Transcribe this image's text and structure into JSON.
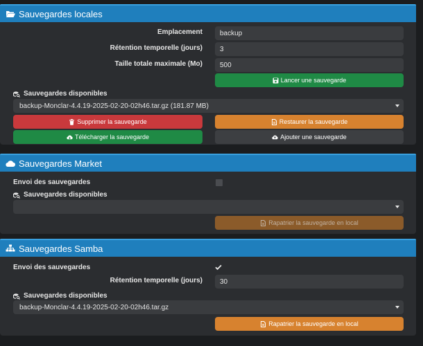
{
  "local": {
    "title": "Sauvegardes locales",
    "labels": {
      "location": "Emplacement",
      "retention": "Rétention temporelle (jours)",
      "max_size": "Taille totale maximale (Mo)",
      "available": "Sauvegardes disponibles"
    },
    "values": {
      "location": "backup",
      "retention": "3",
      "max_size": "500"
    },
    "buttons": {
      "launch": "Lancer une sauvegarde",
      "delete": "Supprimer la sauvegarde",
      "restore": "Restaurer la sauvegarde",
      "download": "Télécharger la sauvegarde",
      "add": "Ajouter une sauvegarde"
    },
    "selected_backup": "backup-Monclar-4.4.19-2025-02-20-02h46.tar.gz (181.87 MB)"
  },
  "market": {
    "title": "Sauvegardes Market",
    "labels": {
      "send": "Envoi des sauvegardes",
      "available": "Sauvegardes disponibles"
    },
    "send_checked": false,
    "selected_backup": "",
    "buttons": {
      "repatriate": "Rapatrier la sauvegarde en local"
    }
  },
  "samba": {
    "title": "Sauvegardes Samba",
    "labels": {
      "send": "Envoi des sauvegardes",
      "retention": "Rétention temporelle (jours)",
      "available": "Sauvegardes disponibles"
    },
    "send_checked": true,
    "values": {
      "retention": "30"
    },
    "selected_backup": "backup-Monclar-4.4.19-2025-02-20-02h46.tar.gz",
    "buttons": {
      "repatriate": "Rapatrier la sauvegarde en local"
    }
  },
  "colors": {
    "header": "#1f7fbd",
    "green": "#1f8a45",
    "red": "#c9393c",
    "orange": "#d7822f",
    "dark_button": "#3d3f42"
  },
  "icons": {
    "local_header": "folder-open-icon",
    "market_header": "cloud-icon",
    "samba_header": "sitemap-icon",
    "available": "search-database-icon",
    "launch": "floppy-icon",
    "delete": "trash-icon",
    "restore": "file-icon",
    "download": "cloud-download-icon",
    "add": "cloud-upload-icon",
    "repatriate": "file-icon",
    "check": "check-icon"
  }
}
